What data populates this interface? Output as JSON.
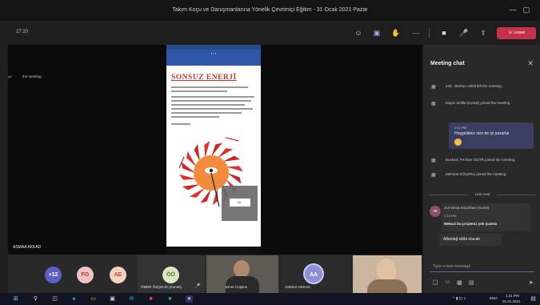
{
  "window": {
    "title": "Takım Koçu ve Danışmanlarına Yönelik Çevrimiçi Eğitim - 31 Ocak 2021 Pazar"
  },
  "toolbar": {
    "timer": "27:20",
    "leave_label": "Leave",
    "icons": [
      "participants-icon",
      "chat-icon",
      "raise-hand-icon",
      "more-icon",
      "camera-icon",
      "mic-icon",
      "share-icon",
      "leave-phone-icon"
    ]
  },
  "stage": {
    "presenter_name": "ASMAA AKKAD"
  },
  "shared_doc": {
    "title": "SONSUZ ENERJİ",
    "popup_button": "Sil..."
  },
  "participants": {
    "overflow": "+12",
    "bubbles": [
      {
        "initials": "FG",
        "bg": "#f0c2c2",
        "fg": "#b03a3a"
      },
      {
        "initials": "AE",
        "bg": "#f3d0c0",
        "fg": "#b8502c"
      },
      {
        "initials": "ÖÖ",
        "bg": "#d9e8c2",
        "fg": "#4e7a1d"
      }
    ],
    "tiles": [
      {
        "name": "ÖMER ÖZÇELİK (Konuk)"
      },
      {
        "name": "Emre Coşkun"
      },
      {
        "name": "ASMAA AKKAD",
        "initials": "AA"
      },
      {
        "name": ""
      }
    ]
  },
  "chat": {
    "header": "Meeting chat",
    "system_messages": [
      {
        "icon": "leave-arrow-icon",
        "text": "the meeting."
      },
      {
        "icon": "join-icon",
        "text": "240 - Berkan Akfeli left the meeting."
      },
      {
        "icon": "join-icon",
        "text": "büşra ceritlik (Konuk) joined the meeting."
      },
      {
        "icon": "join-icon",
        "text": "Bozkurt, Perihan GİZTR joined the meeting."
      },
      {
        "icon": "join-icon",
        "text": "Mehmet KÖÇERLİ joined the meeting."
      }
    ],
    "my_message": {
      "time": "1:01 PM",
      "text": "Hoşgeldiniz size de iyi pazarlar"
    },
    "last_read": "Last read",
    "guest_message": {
      "avatar": "3K",
      "name": "210-Deva Köçürhan (Guest)",
      "time": "1:19 PM",
      "text": "Mekozi bu projemiz yok şuanta"
    },
    "reply_message": "Albedağ ekibi olacak",
    "composer_placeholder": "Type a new message"
  },
  "taskbar": {
    "lang": "ENG",
    "time": "1:21 PM",
    "date": "31.01.2021"
  },
  "colors": {
    "accent": "#6264a7",
    "leave": "#c4314b",
    "doc_title": "#c0392b",
    "wheel_red": "#e0302a",
    "wheel_orange": "#f08a3c"
  }
}
